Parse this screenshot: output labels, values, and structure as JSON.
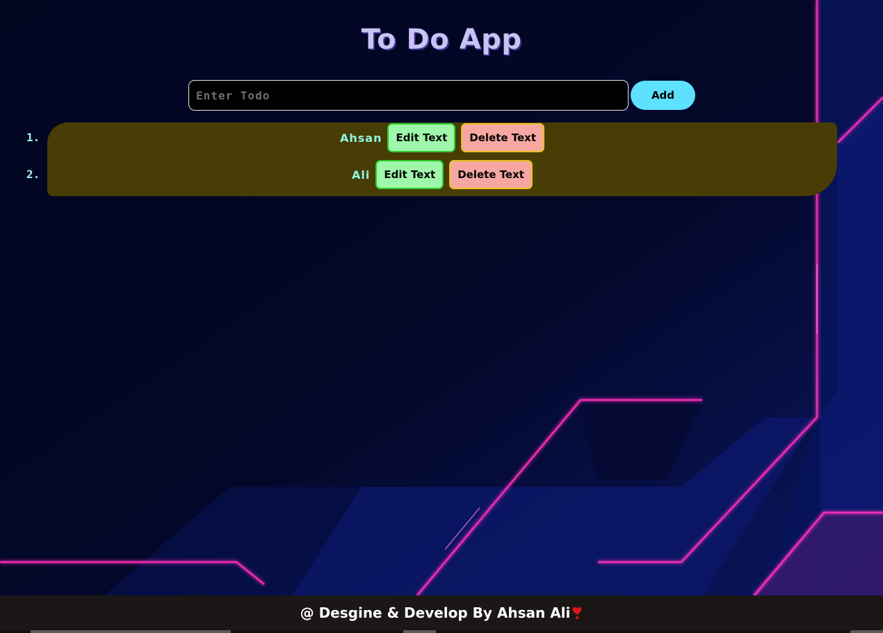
{
  "header": {
    "title": "To Do App"
  },
  "form": {
    "input_placeholder": "Enter Todo",
    "input_value": "",
    "add_label": "Add"
  },
  "todos": [
    {
      "number": "1.",
      "text": "Ahsan",
      "edit_label": "Edit Text",
      "delete_label": "Delete Text"
    },
    {
      "number": "2.",
      "text": "Ali",
      "edit_label": "Edit Text",
      "delete_label": "Delete Text"
    }
  ],
  "footer": {
    "text": "@ Desgine & Develop By Ahsan Ali",
    "icon": "heart-icon"
  },
  "colors": {
    "background": "#030724",
    "title": "#c9c3f4",
    "add_button": "#5ee0ff",
    "list_box": "#473d05",
    "todo_text": "#8ff5e2",
    "edit_button": "#9ef7aa",
    "delete_button": "#f7a7a2",
    "footer_bg": "#1b1716",
    "neon_accent": "#ff2fb8"
  }
}
